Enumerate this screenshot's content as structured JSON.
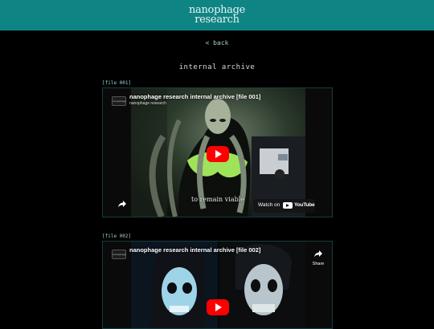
{
  "header": {
    "logo_line1": "nanophage",
    "logo_line2": "research",
    "accent_color": "#0f8484"
  },
  "nav": {
    "back": "< back"
  },
  "page": {
    "title": "internal archive"
  },
  "files": [
    {
      "label": "[file 001]",
      "video_title": "nanophage research internal archive [file 001]",
      "channel": "nanophage research",
      "subtitle": "to remain viable",
      "watch_on": "Watch on",
      "youtube": "YouTube",
      "badge": "nanophage"
    },
    {
      "label": "[file 002]",
      "video_title": "nanophage research internal archive [file 002]",
      "share": "Share",
      "badge": "nanophage"
    }
  ]
}
